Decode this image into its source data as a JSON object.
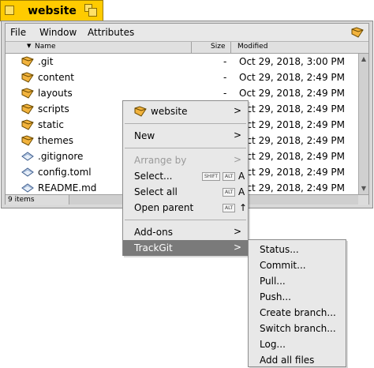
{
  "window": {
    "title": "website",
    "menus": [
      "File",
      "Window",
      "Attributes"
    ],
    "columns": {
      "name": "Name",
      "size": "Size",
      "modified": "Modified"
    },
    "status": "9 items"
  },
  "files": [
    {
      "name": ".git",
      "size": "-",
      "modified": "Oct 29, 2018, 3:00 PM",
      "icon": "folder-icon"
    },
    {
      "name": "content",
      "size": "-",
      "modified": "Oct 29, 2018, 2:49 PM",
      "icon": "folder-icon"
    },
    {
      "name": "layouts",
      "size": "-",
      "modified": "Oct 29, 2018, 2:49 PM",
      "icon": "folder-icon"
    },
    {
      "name": "scripts",
      "size": "-",
      "modified": "Oct 29, 2018, 2:49 PM",
      "icon": "folder-icon"
    },
    {
      "name": "static",
      "size": "-",
      "modified": "Oct 29, 2018, 2:49 PM",
      "icon": "folder-icon"
    },
    {
      "name": "themes",
      "size": "-",
      "modified": "Oct 29, 2018, 2:49 PM",
      "icon": "folder-icon"
    },
    {
      "name": ".gitignore",
      "size": "-",
      "modified": "Oct 29, 2018, 2:49 PM",
      "icon": "file-icon"
    },
    {
      "name": "config.toml",
      "size": "-",
      "modified": "Oct 29, 2018, 2:49 PM",
      "icon": "file-icon"
    },
    {
      "name": "README.md",
      "size": "-",
      "modified": "Oct 29, 2018, 2:49 PM",
      "icon": "file-icon"
    }
  ],
  "context_menu": {
    "header": "website",
    "new": "New",
    "arrange_by": "Arrange by",
    "select": "Select...",
    "select_keys": [
      "SHIFT",
      "ALT"
    ],
    "select_letter": "A",
    "select_all": "Select all",
    "select_all_keys": [
      "ALT"
    ],
    "select_all_letter": "A",
    "open_parent": "Open parent",
    "open_parent_keys": [
      "ALT"
    ],
    "open_parent_glyph": "↑",
    "add_ons": "Add-ons",
    "trackgit": "TrackGit"
  },
  "submenu": [
    "Status...",
    "Commit...",
    "Pull...",
    "Push...",
    "Create branch...",
    "Switch branch...",
    "Log...",
    "Add all files"
  ],
  "colors": {
    "title_tab": "#ffcb00",
    "highlight": "#7a7a7a",
    "folder": "#f2b33d"
  }
}
